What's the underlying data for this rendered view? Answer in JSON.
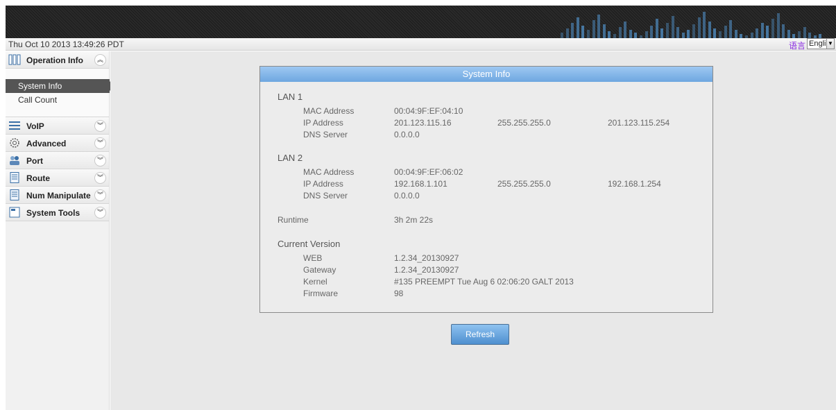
{
  "status": {
    "datetime": "Thu Oct 10 2013 13:49:26 PDT",
    "language_label": "语言",
    "language_value": "English"
  },
  "sidebar": {
    "operation_info": {
      "label": "Operation Info",
      "sub": [
        "System Info",
        "Call Count"
      ]
    },
    "items": [
      {
        "label": "VoIP",
        "icon": "sliders-icon"
      },
      {
        "label": "Advanced",
        "icon": "gear-icon"
      },
      {
        "label": "Port",
        "icon": "users-icon"
      },
      {
        "label": "Route",
        "icon": "document-icon"
      },
      {
        "label": "Num Manipulate",
        "icon": "document-icon"
      },
      {
        "label": "System Tools",
        "icon": "toolbox-icon"
      }
    ]
  },
  "panel": {
    "title": "System Info",
    "lan1": {
      "heading": "LAN 1",
      "mac_label": "MAC Address",
      "mac": "00:04:9F:EF:04:10",
      "ip_label": "IP Address",
      "ip": "201.123.115.16",
      "mask": "255.255.255.0",
      "gateway": "201.123.115.254",
      "dns_label": "DNS Server",
      "dns": "0.0.0.0"
    },
    "lan2": {
      "heading": "LAN 2",
      "mac_label": "MAC Address",
      "mac": "00:04:9F:EF:06:02",
      "ip_label": "IP Address",
      "ip": "192.168.1.101",
      "mask": "255.255.255.0",
      "gateway": "192.168.1.254",
      "dns_label": "DNS Server",
      "dns": "0.0.0.0"
    },
    "runtime": {
      "label": "Runtime",
      "value": "3h 2m 22s"
    },
    "version": {
      "heading": "Current Version",
      "web_label": "WEB",
      "web": "1.2.34_20130927",
      "gateway_label": "Gateway",
      "gateway": "1.2.34_20130927",
      "kernel_label": "Kernel",
      "kernel": "#135 PREEMPT Tue Aug 6 02:06:20 GALT 2013",
      "firmware_label": "Firmware",
      "firmware": "98"
    }
  },
  "refresh_label": "Refresh",
  "colors": {
    "accent": "#6ea7e0",
    "banner": "#222222",
    "eq": "#4a7fae"
  }
}
